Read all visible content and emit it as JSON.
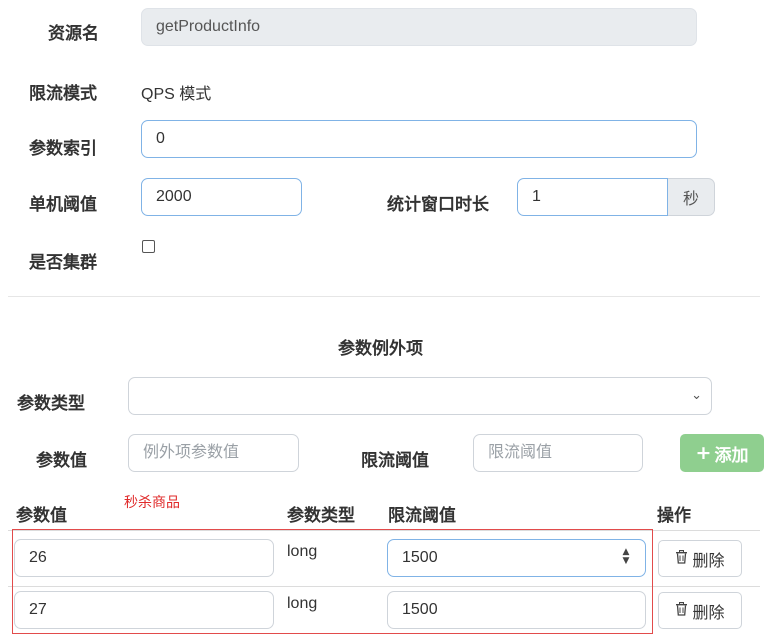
{
  "form": {
    "resource_name": {
      "label": "资源名",
      "value": "getProductInfo"
    },
    "limit_mode": {
      "label": "限流模式",
      "value": "QPS 模式"
    },
    "param_index": {
      "label": "参数索引",
      "value": "0"
    },
    "single_threshold": {
      "label": "单机阈值",
      "value": "2000"
    },
    "stat_window": {
      "label": "统计窗口时长",
      "value": "1",
      "unit": "秒"
    },
    "cluster": {
      "label": "是否集群",
      "checked": false
    }
  },
  "exception": {
    "section_title": "参数例外项",
    "param_type_label": "参数类型",
    "param_type_value": "",
    "param_value_label": "参数值",
    "param_value_placeholder": "例外项参数值",
    "threshold_label": "限流阈值",
    "threshold_placeholder": "限流阈值",
    "add_button": "添加"
  },
  "table": {
    "headers": [
      "参数值",
      "参数类型",
      "限流阈值",
      "操作"
    ],
    "annotation": "秒杀商品",
    "rows": [
      {
        "value": "26",
        "type": "long",
        "threshold": "1500",
        "action": "删除"
      },
      {
        "value": "27",
        "type": "long",
        "threshold": "1500",
        "action": "删除"
      }
    ]
  },
  "colors": {
    "add_button": "#8fcf8f",
    "annotation_red": "#e24b4b",
    "focus_border": "#80b3e6"
  }
}
